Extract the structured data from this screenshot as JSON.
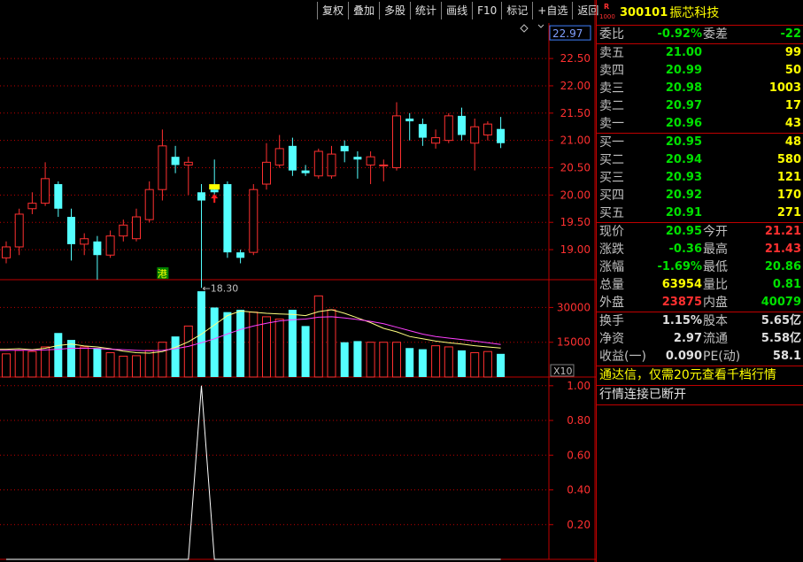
{
  "toolbar": [
    "复权",
    "叠加",
    "多股",
    "统计",
    "画线",
    "F10",
    "标记",
    "+自选",
    "返回"
  ],
  "stock": {
    "badge_r": "R",
    "badge_num": "1000",
    "code": "300101",
    "name": "振芯科技"
  },
  "weibi": {
    "label": "委比",
    "value": "-0.92%",
    "label2": "委差",
    "value2": "-22"
  },
  "asks": [
    {
      "label": "卖五",
      "price": "21.00",
      "vol": "99"
    },
    {
      "label": "卖四",
      "price": "20.99",
      "vol": "50"
    },
    {
      "label": "卖三",
      "price": "20.98",
      "vol": "1003"
    },
    {
      "label": "卖二",
      "price": "20.97",
      "vol": "17"
    },
    {
      "label": "卖一",
      "price": "20.96",
      "vol": "43"
    }
  ],
  "bids": [
    {
      "label": "买一",
      "price": "20.95",
      "vol": "48"
    },
    {
      "label": "买二",
      "price": "20.94",
      "vol": "580"
    },
    {
      "label": "买三",
      "price": "20.93",
      "vol": "121"
    },
    {
      "label": "买四",
      "price": "20.92",
      "vol": "170"
    },
    {
      "label": "买五",
      "price": "20.91",
      "vol": "271"
    }
  ],
  "quote": [
    {
      "l1": "现价",
      "v1": "20.95",
      "c1": "green",
      "l2": "今开",
      "v2": "21.21",
      "c2": "red"
    },
    {
      "l1": "涨跌",
      "v1": "-0.36",
      "c1": "green",
      "l2": "最高",
      "v2": "21.43",
      "c2": "red"
    },
    {
      "l1": "涨幅",
      "v1": "-1.69%",
      "c1": "green",
      "l2": "最低",
      "v2": "20.86",
      "c2": "green"
    },
    {
      "l1": "总量",
      "v1": "63954",
      "c1": "yellow",
      "l2": "量比",
      "v2": "0.81",
      "c2": "green"
    },
    {
      "l1": "外盘",
      "v1": "23875",
      "c1": "red",
      "l2": "内盘",
      "v2": "40079",
      "c2": "green"
    }
  ],
  "fund": [
    {
      "l1": "换手",
      "v1": "1.15%",
      "l2": "股本",
      "v2": "5.65亿"
    },
    {
      "l1": "净资",
      "v1": "2.97",
      "l2": "流通",
      "v2": "5.58亿"
    },
    {
      "l1": "收益(一)",
      "v1": "0.090",
      "l2": "PE(动)",
      "v2": "58.1"
    }
  ],
  "notice": "通达信，仅需20元查看千档行情",
  "disconnect": "行情连接已断开",
  "colors": {
    "up": "#ff3030",
    "down": "#54ffff",
    "grid": "#c00000",
    "ma_vol1": "#ffff80",
    "ma_vol2": "#ff40ff",
    "indicator": "#ffffff"
  },
  "chart_data": [
    {
      "type": "candlestick",
      "y_axis_labels": [
        "22.97",
        "22.50",
        "22.00",
        "21.50",
        "21.00",
        "20.50",
        "20.00",
        "19.50",
        "19.00"
      ],
      "ylim": [
        18.45,
        23.15
      ],
      "price_marker": "22.97",
      "low_label": "←18.30",
      "low_value": 18.3,
      "tag": "港",
      "candles": [
        {
          "o": 18.85,
          "c": 19.05,
          "h": 19.15,
          "l": 18.75
        },
        {
          "o": 19.05,
          "c": 19.65,
          "h": 19.75,
          "l": 18.9
        },
        {
          "o": 19.75,
          "c": 19.85,
          "h": 20.05,
          "l": 19.65
        },
        {
          "o": 19.85,
          "c": 20.3,
          "h": 20.6,
          "l": 19.8
        },
        {
          "o": 20.2,
          "c": 19.75,
          "h": 20.25,
          "l": 19.6
        },
        {
          "o": 19.6,
          "c": 19.1,
          "h": 19.75,
          "l": 18.8
        },
        {
          "o": 19.1,
          "c": 19.2,
          "h": 19.3,
          "l": 18.9
        },
        {
          "o": 19.15,
          "c": 18.9,
          "h": 19.25,
          "l": 18.45
        },
        {
          "o": 18.9,
          "c": 19.25,
          "h": 19.35,
          "l": 18.85
        },
        {
          "o": 19.25,
          "c": 19.45,
          "h": 19.55,
          "l": 19.15
        },
        {
          "o": 19.2,
          "c": 19.6,
          "h": 19.75,
          "l": 19.15
        },
        {
          "o": 19.55,
          "c": 20.1,
          "h": 20.25,
          "l": 19.5
        },
        {
          "o": 20.1,
          "c": 20.9,
          "h": 21.2,
          "l": 19.9
        },
        {
          "o": 20.7,
          "c": 20.55,
          "h": 20.9,
          "l": 20.4
        },
        {
          "o": 20.55,
          "c": 20.6,
          "h": 20.7,
          "l": 20.0
        },
        {
          "o": 20.05,
          "c": 19.9,
          "h": 20.2,
          "l": 18.3
        },
        {
          "o": 20.1,
          "c": 20.05,
          "h": 20.65,
          "l": 19.9
        },
        {
          "o": 20.2,
          "c": 18.95,
          "h": 20.25,
          "l": 18.85
        },
        {
          "o": 18.95,
          "c": 18.85,
          "h": 19.0,
          "l": 18.75
        },
        {
          "o": 18.95,
          "c": 20.1,
          "h": 20.2,
          "l": 18.9
        },
        {
          "o": 20.2,
          "c": 20.6,
          "h": 20.95,
          "l": 20.1
        },
        {
          "o": 20.55,
          "c": 20.85,
          "h": 21.1,
          "l": 20.5
        },
        {
          "o": 20.9,
          "c": 20.45,
          "h": 21.05,
          "l": 20.35
        },
        {
          "o": 20.45,
          "c": 20.4,
          "h": 20.55,
          "l": 20.35
        },
        {
          "o": 20.35,
          "c": 20.8,
          "h": 20.85,
          "l": 20.3
        },
        {
          "o": 20.35,
          "c": 20.75,
          "h": 20.9,
          "l": 20.3
        },
        {
          "o": 20.9,
          "c": 20.8,
          "h": 21.0,
          "l": 20.6
        },
        {
          "o": 20.7,
          "c": 20.65,
          "h": 20.8,
          "l": 20.3
        },
        {
          "o": 20.55,
          "c": 20.7,
          "h": 20.8,
          "l": 20.2
        },
        {
          "o": 20.55,
          "c": 20.55,
          "h": 20.65,
          "l": 20.25
        },
        {
          "o": 20.5,
          "c": 21.45,
          "h": 21.7,
          "l": 20.45
        },
        {
          "o": 21.4,
          "c": 21.35,
          "h": 21.5,
          "l": 21.0
        },
        {
          "o": 21.3,
          "c": 21.05,
          "h": 21.4,
          "l": 20.9
        },
        {
          "o": 20.95,
          "c": 21.05,
          "h": 21.2,
          "l": 20.85
        },
        {
          "o": 21.0,
          "c": 21.45,
          "h": 21.5,
          "l": 20.95
        },
        {
          "o": 21.45,
          "c": 21.1,
          "h": 21.6,
          "l": 21.0
        },
        {
          "o": 20.95,
          "c": 21.25,
          "h": 21.4,
          "l": 20.45
        },
        {
          "o": 21.1,
          "c": 21.3,
          "h": 21.35,
          "l": 21.0
        },
        {
          "o": 21.21,
          "c": 20.95,
          "h": 21.43,
          "l": 20.86
        }
      ]
    },
    {
      "type": "bar",
      "y_axis_labels": [
        "30000",
        "15000"
      ],
      "ylim": [
        0,
        42000
      ],
      "label": "X10",
      "values": [
        10000,
        11500,
        11000,
        13000,
        19000,
        16000,
        13000,
        12500,
        10500,
        9000,
        9200,
        11500,
        15000,
        17500,
        22000,
        37000,
        30000,
        28000,
        29000,
        28000,
        26000,
        25000,
        29000,
        22000,
        35000,
        29000,
        15000,
        15500,
        15000,
        15000,
        15000,
        12500,
        12000,
        13500,
        13000,
        11500,
        10500,
        11000,
        10000
      ],
      "ma1": [
        12000,
        12200,
        11800,
        12400,
        13600,
        14200,
        13400,
        13000,
        12200,
        11200,
        10500,
        10300,
        11000,
        12800,
        15200,
        18500,
        22500,
        26500,
        28500,
        28000,
        27500,
        27200,
        27000,
        26500,
        28200,
        29000,
        27500,
        25500,
        23500,
        21000,
        19500,
        17500,
        16500,
        15500,
        14800,
        14200,
        13500,
        13000,
        12500
      ],
      "ma2": [
        11500,
        11600,
        11500,
        11700,
        12000,
        12400,
        12400,
        12300,
        12000,
        11800,
        11500,
        11300,
        11500,
        12200,
        13200,
        14800,
        16500,
        18600,
        20500,
        22000,
        23200,
        24200,
        24700,
        25000,
        25800,
        26000,
        25500,
        24800,
        24000,
        23000,
        21500,
        20000,
        18500,
        17500,
        16800,
        16200,
        15500,
        14800,
        14000
      ]
    },
    {
      "type": "line",
      "y_axis_labels": [
        "1.00",
        "0.80",
        "0.60",
        "0.40",
        "0.20"
      ],
      "ylim": [
        0,
        1.05
      ],
      "values": [
        0,
        0,
        0,
        0,
        0,
        0,
        0,
        0,
        0,
        0,
        0,
        0,
        0,
        0,
        0,
        1,
        0,
        0,
        0,
        0,
        0,
        0,
        0,
        0,
        0,
        0,
        0,
        0,
        0,
        0,
        0,
        0,
        0,
        0,
        0,
        0,
        0,
        0,
        0
      ]
    }
  ]
}
